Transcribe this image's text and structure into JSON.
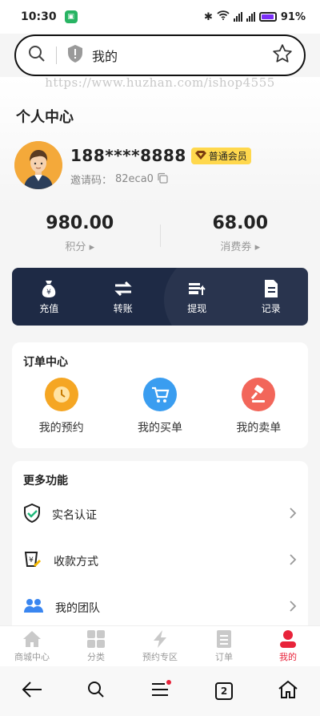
{
  "status_bar": {
    "time": "10:30",
    "battery": "91%",
    "network": "5G"
  },
  "search": {
    "title": "我的"
  },
  "watermark": "https://www.huzhan.com/ishop4555",
  "profile": {
    "heading": "个人中心",
    "phone": "188****8888",
    "member_level": "普通会员",
    "invite_label": "邀请码：",
    "invite_code": "82eca0"
  },
  "stats": [
    {
      "value": "980.00",
      "label": "积分"
    },
    {
      "value": "68.00",
      "label": "消费券"
    }
  ],
  "wallet_actions": [
    {
      "label": "充值",
      "icon": "money-bag-icon"
    },
    {
      "label": "转账",
      "icon": "transfer-arrows-icon"
    },
    {
      "label": "提现",
      "icon": "withdraw-icon"
    },
    {
      "label": "记录",
      "icon": "record-icon"
    }
  ],
  "orders": {
    "title": "订单中心",
    "items": [
      {
        "label": "我的预约",
        "icon": "clock-icon",
        "color": "#f5a623"
      },
      {
        "label": "我的买单",
        "icon": "cart-icon",
        "color": "#3a9df0"
      },
      {
        "label": "我的卖单",
        "icon": "gavel-icon",
        "color": "#f2665a"
      }
    ]
  },
  "more": {
    "title": "更多功能",
    "items": [
      {
        "label": "实名认证",
        "icon": "shield-check-icon"
      },
      {
        "label": "收款方式",
        "icon": "payment-method-icon"
      },
      {
        "label": "我的团队",
        "icon": "team-icon"
      }
    ]
  },
  "tabbar": [
    {
      "label": "商城中心",
      "icon": "home-icon"
    },
    {
      "label": "分类",
      "icon": "grid-icon"
    },
    {
      "label": "预约专区",
      "icon": "lightning-icon"
    },
    {
      "label": "订单",
      "icon": "list-icon"
    },
    {
      "label": "我的",
      "icon": "person-icon",
      "active": true
    }
  ],
  "navbar": {
    "tab_count": "2"
  },
  "colors": {
    "accent": "#e8233a",
    "wallet_bg": "#1e2a45",
    "badge": "#ffd84d"
  }
}
